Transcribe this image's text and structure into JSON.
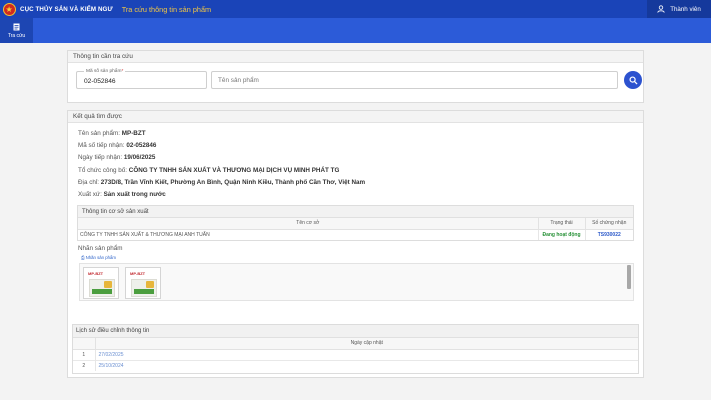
{
  "header": {
    "org_name": "CỤC THỦY SẢN VÀ KIỂM NGƯ",
    "app_title": "Tra cứu thông tin sản phẩm",
    "user_label": "Thành viên"
  },
  "nav": {
    "lookup_label": "Tra cứu"
  },
  "search_panel": {
    "title": "Thông tin cần tra cứu",
    "code_field_label": "Mã số sản phẩm",
    "code_field_required_mark": "*",
    "code_field_value": "02-052846",
    "name_field_placeholder": "Tên sản phẩm"
  },
  "result_panel": {
    "title": "Kết quả tìm được",
    "fields": [
      {
        "label": "Tên sản phẩm: ",
        "value": "MP-BZT"
      },
      {
        "label": "Mã số tiếp nhận: ",
        "value": "02-052846"
      },
      {
        "label": "Ngày tiếp nhận: ",
        "value": "19/06/2025"
      },
      {
        "label": "Tổ chức công bố: ",
        "value": "CÔNG TY TNHH SẢN XUẤT VÀ THƯƠNG MẠI DỊCH VỤ MINH PHÁT TG"
      },
      {
        "label": "Địa chỉ: ",
        "value": "273D/8, Trần Vĩnh Kiết, Phường An Bình, Quận Ninh Kiều, Thành phố Cần Thơ, Việt Nam"
      },
      {
        "label": "Xuất xứ: ",
        "value": "Sản xuất trong nước"
      }
    ],
    "facility": {
      "title": "Thông tin cơ sở sản xuất",
      "columns": [
        "Tên cơ sở",
        "Trạng thái",
        "Số chứng nhận"
      ],
      "rows": [
        {
          "name": "CÔNG TY TNHH SẢN XUẤT & THƯƠNG MẠI ANH TUẤN",
          "status": "Đang hoạt động",
          "cert": "TS930022"
        }
      ]
    },
    "labels": {
      "title": "Nhãn sản phẩm",
      "subtitle": "Nhãn sản phẩm",
      "images": [
        {
          "text": "MP-BZT"
        },
        {
          "text": "MP-BZT"
        }
      ]
    }
  },
  "history": {
    "title": "Lịch sử điều chỉnh thông tin",
    "column": "Ngày cập nhật",
    "rows": [
      {
        "index": "1",
        "date": "27/02/2025"
      },
      {
        "index": "2",
        "date": "25/10/2024"
      }
    ]
  },
  "colors": {
    "header_bg": "#1a44b8",
    "subbar_bg": "#2c5bd8",
    "app_title": "#f4c842",
    "status_active": "#279137",
    "link": "#2a58c9"
  }
}
